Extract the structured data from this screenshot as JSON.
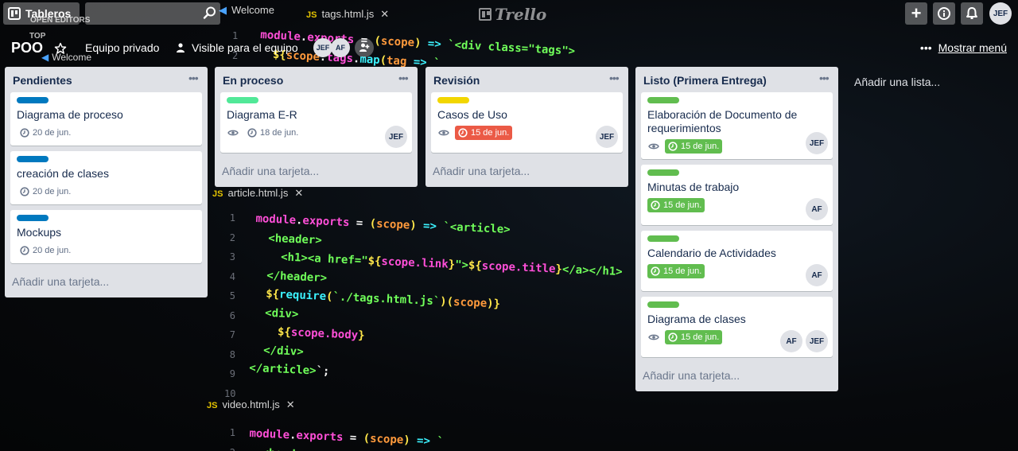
{
  "nav": {
    "boards_label": "Tableros",
    "search_placeholder": "",
    "logo_text": "Trello",
    "avatar": "JEF"
  },
  "board": {
    "title": "POO",
    "team": "Equipo privado",
    "visibility": "Visible para el equipo",
    "members": [
      "JEF",
      "AF"
    ],
    "menu_label": "Mostrar menú"
  },
  "lists": [
    {
      "title": "Pendientes",
      "cards": [
        {
          "label_color": "#0079bf",
          "title": "Diagrama de proceso",
          "due": "20 de jun.",
          "due_status": "normal",
          "watched": false,
          "members": []
        },
        {
          "label_color": "#0079bf",
          "title": "creación de clases",
          "due": "20 de jun.",
          "due_status": "normal",
          "watched": false,
          "members": []
        },
        {
          "label_color": "#0079bf",
          "title": "Mockups",
          "due": "20 de jun.",
          "due_status": "normal",
          "watched": false,
          "members": []
        }
      ],
      "add_card": "Añadir una tarjeta..."
    },
    {
      "title": "En proceso",
      "cards": [
        {
          "label_color": "#51e898",
          "title": "Diagrama E-R",
          "due": "18 de jun.",
          "due_status": "normal",
          "watched": true,
          "members": [
            "JEF"
          ]
        }
      ],
      "add_card": "Añadir una tarjeta..."
    },
    {
      "title": "Revisión",
      "cards": [
        {
          "label_color": "#f2d600",
          "title": "Casos de Uso",
          "due": "15 de jun.",
          "due_status": "overdue",
          "watched": true,
          "members": [
            "JEF"
          ]
        }
      ],
      "add_card": "Añadir una tarjeta..."
    },
    {
      "title": "Listo (Primera Entrega)",
      "cards": [
        {
          "label_color": "#61bd4f",
          "title": "Elaboración de Documento de requerimientos",
          "due": "15 de jun.",
          "due_status": "done",
          "watched": true,
          "members": [
            "JEF"
          ]
        },
        {
          "label_color": "#61bd4f",
          "title": "Minutas de trabajo",
          "due": "15 de jun.",
          "due_status": "done",
          "watched": false,
          "members": [
            "AF"
          ]
        },
        {
          "label_color": "#61bd4f",
          "title": "Calendario de Actividades",
          "due": "15 de jun.",
          "due_status": "done",
          "watched": false,
          "members": [
            "AF"
          ]
        },
        {
          "label_color": "#61bd4f",
          "title": "Diagrama de clases",
          "due": "15 de jun.",
          "due_status": "done",
          "watched": true,
          "members": [
            "AF",
            "JEF"
          ]
        }
      ],
      "add_card": "Añadir una tarjeta..."
    }
  ],
  "add_list": "Añadir una lista...",
  "background_code": {
    "tabs": [
      "Welcome",
      "tags.html.js",
      "article.html.js",
      "video.html.js"
    ],
    "side_labels": [
      "OPEN EDITORS",
      "TOP",
      "Welcome"
    ]
  }
}
